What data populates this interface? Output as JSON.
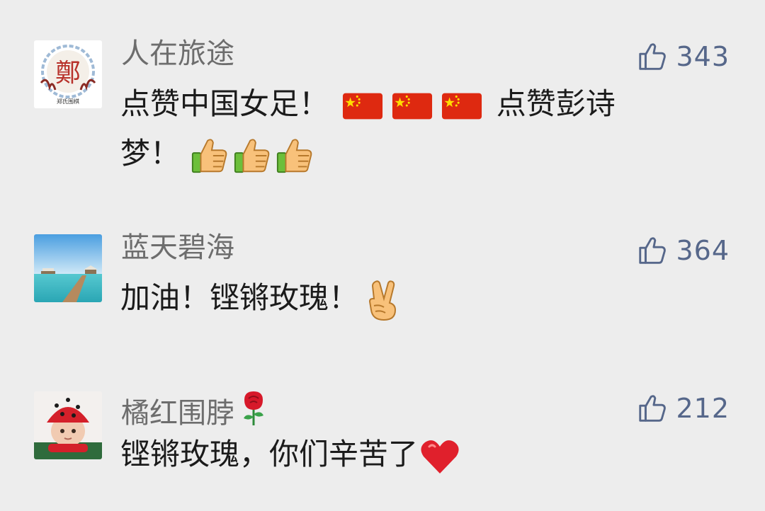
{
  "comments": [
    {
      "name": "人在旅途",
      "likes": "343",
      "text_before_flags": "点赞中国女足！",
      "text_after_flags": "点赞彭诗",
      "text_line2": "梦！",
      "avatar_icon": "zheng-seal-logo",
      "avatar_caption": "郑氏围棋"
    },
    {
      "name": "蓝天碧海",
      "likes": "364",
      "text": "加油！铿锵玫瑰！",
      "avatar_icon": "beach-pier-photo"
    },
    {
      "name": "橘红围脖",
      "likes": "212",
      "text": "铿锵玫瑰，你们辛苦了",
      "avatar_icon": "baby-red-hat-photo"
    }
  ],
  "colors": {
    "background": "#ededed",
    "name": "#6d6d6d",
    "text": "#1b1b1b",
    "like": "#56678a"
  }
}
